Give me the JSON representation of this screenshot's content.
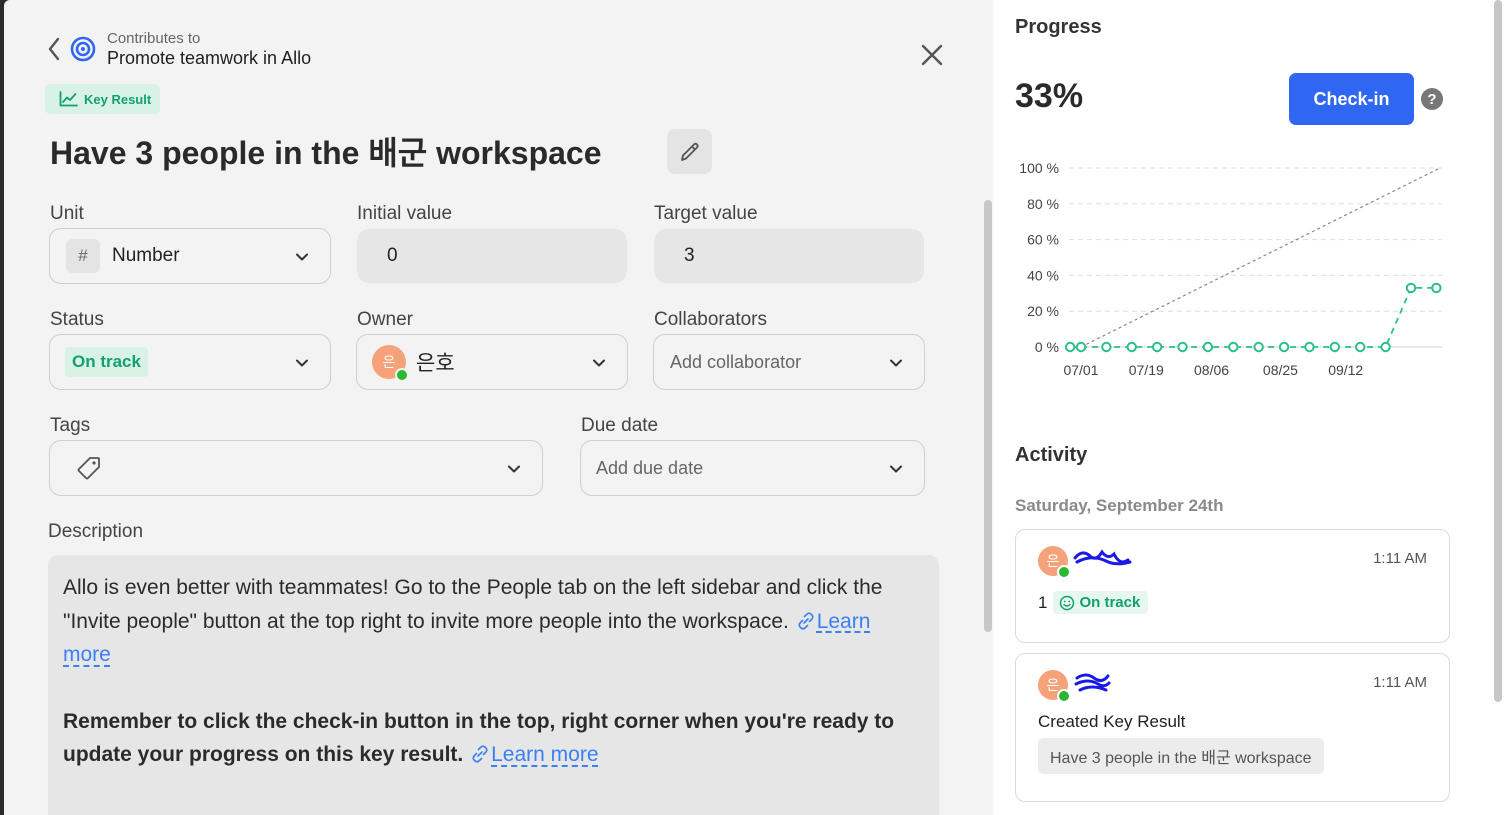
{
  "breadcrumb": {
    "contributes_label": "Contributes to",
    "objective": "Promote teamwork in Allo"
  },
  "badge": {
    "label": "Key Result"
  },
  "title": "Have 3 people in the 배군 workspace",
  "fields": {
    "unit": {
      "label": "Unit",
      "symbol": "#",
      "value": "Number"
    },
    "initial": {
      "label": "Initial value",
      "value": "0"
    },
    "target": {
      "label": "Target value",
      "value": "3"
    },
    "status": {
      "label": "Status",
      "value": "On track"
    },
    "owner": {
      "label": "Owner",
      "avatar_initial": "은",
      "name": "은호"
    },
    "collaborators": {
      "label": "Collaborators",
      "placeholder": "Add collaborator"
    },
    "tags": {
      "label": "Tags"
    },
    "due": {
      "label": "Due date",
      "placeholder": "Add due date"
    }
  },
  "description": {
    "label": "Description",
    "para1": "Allo is even better with teammates! Go to the People tab on the left sidebar and click the \"Invite people\" button at the top right to invite more people into the workspace.",
    "para2": "Remember to click the check-in button in the top, right corner when you're ready to update your progress on this key result.",
    "learn_more": "Learn more"
  },
  "progress": {
    "heading": "Progress",
    "percent": "33%",
    "checkin_label": "Check-in",
    "help": "?"
  },
  "chart_data": {
    "type": "line",
    "y_ticks": [
      "100 %",
      "80 %",
      "60 %",
      "40 %",
      "20 %",
      "0 %"
    ],
    "x_ticks": [
      "07/01",
      "07/19",
      "08/06",
      "08/25",
      "09/12"
    ],
    "ylim": [
      0,
      100
    ],
    "grid": true,
    "colors": {
      "actual": "#2bbf8a",
      "expected": "#888888"
    },
    "series": [
      {
        "points": [
          [
            "2022-06-28",
            0
          ],
          [
            "2022-07-01",
            0
          ],
          [
            "2022-07-08",
            0
          ],
          [
            "2022-07-15",
            0
          ],
          [
            "2022-07-22",
            0
          ],
          [
            "2022-07-29",
            0
          ],
          [
            "2022-08-05",
            0
          ],
          [
            "2022-08-12",
            0
          ],
          [
            "2022-08-19",
            0
          ],
          [
            "2022-08-26",
            0
          ],
          [
            "2022-09-02",
            0
          ],
          [
            "2022-09-09",
            0
          ],
          [
            "2022-09-16",
            0
          ],
          [
            "2022-09-23",
            0
          ],
          [
            "2022-09-30",
            33
          ],
          [
            "2022-10-07",
            33
          ]
        ]
      },
      {
        "points": [
          [
            "2022-07-01",
            0
          ],
          [
            "2022-10-08",
            100
          ]
        ]
      }
    ]
  },
  "activity": {
    "heading": "Activity",
    "date": "Saturday, September 24th",
    "items": [
      {
        "avatar_initial": "은",
        "time": "1:11 AM",
        "value": "1",
        "status": "On track"
      },
      {
        "avatar_initial": "은",
        "time": "1:11 AM",
        "text": "Created Key Result",
        "chip": "Have 3 people in the 배군 workspace"
      }
    ]
  }
}
